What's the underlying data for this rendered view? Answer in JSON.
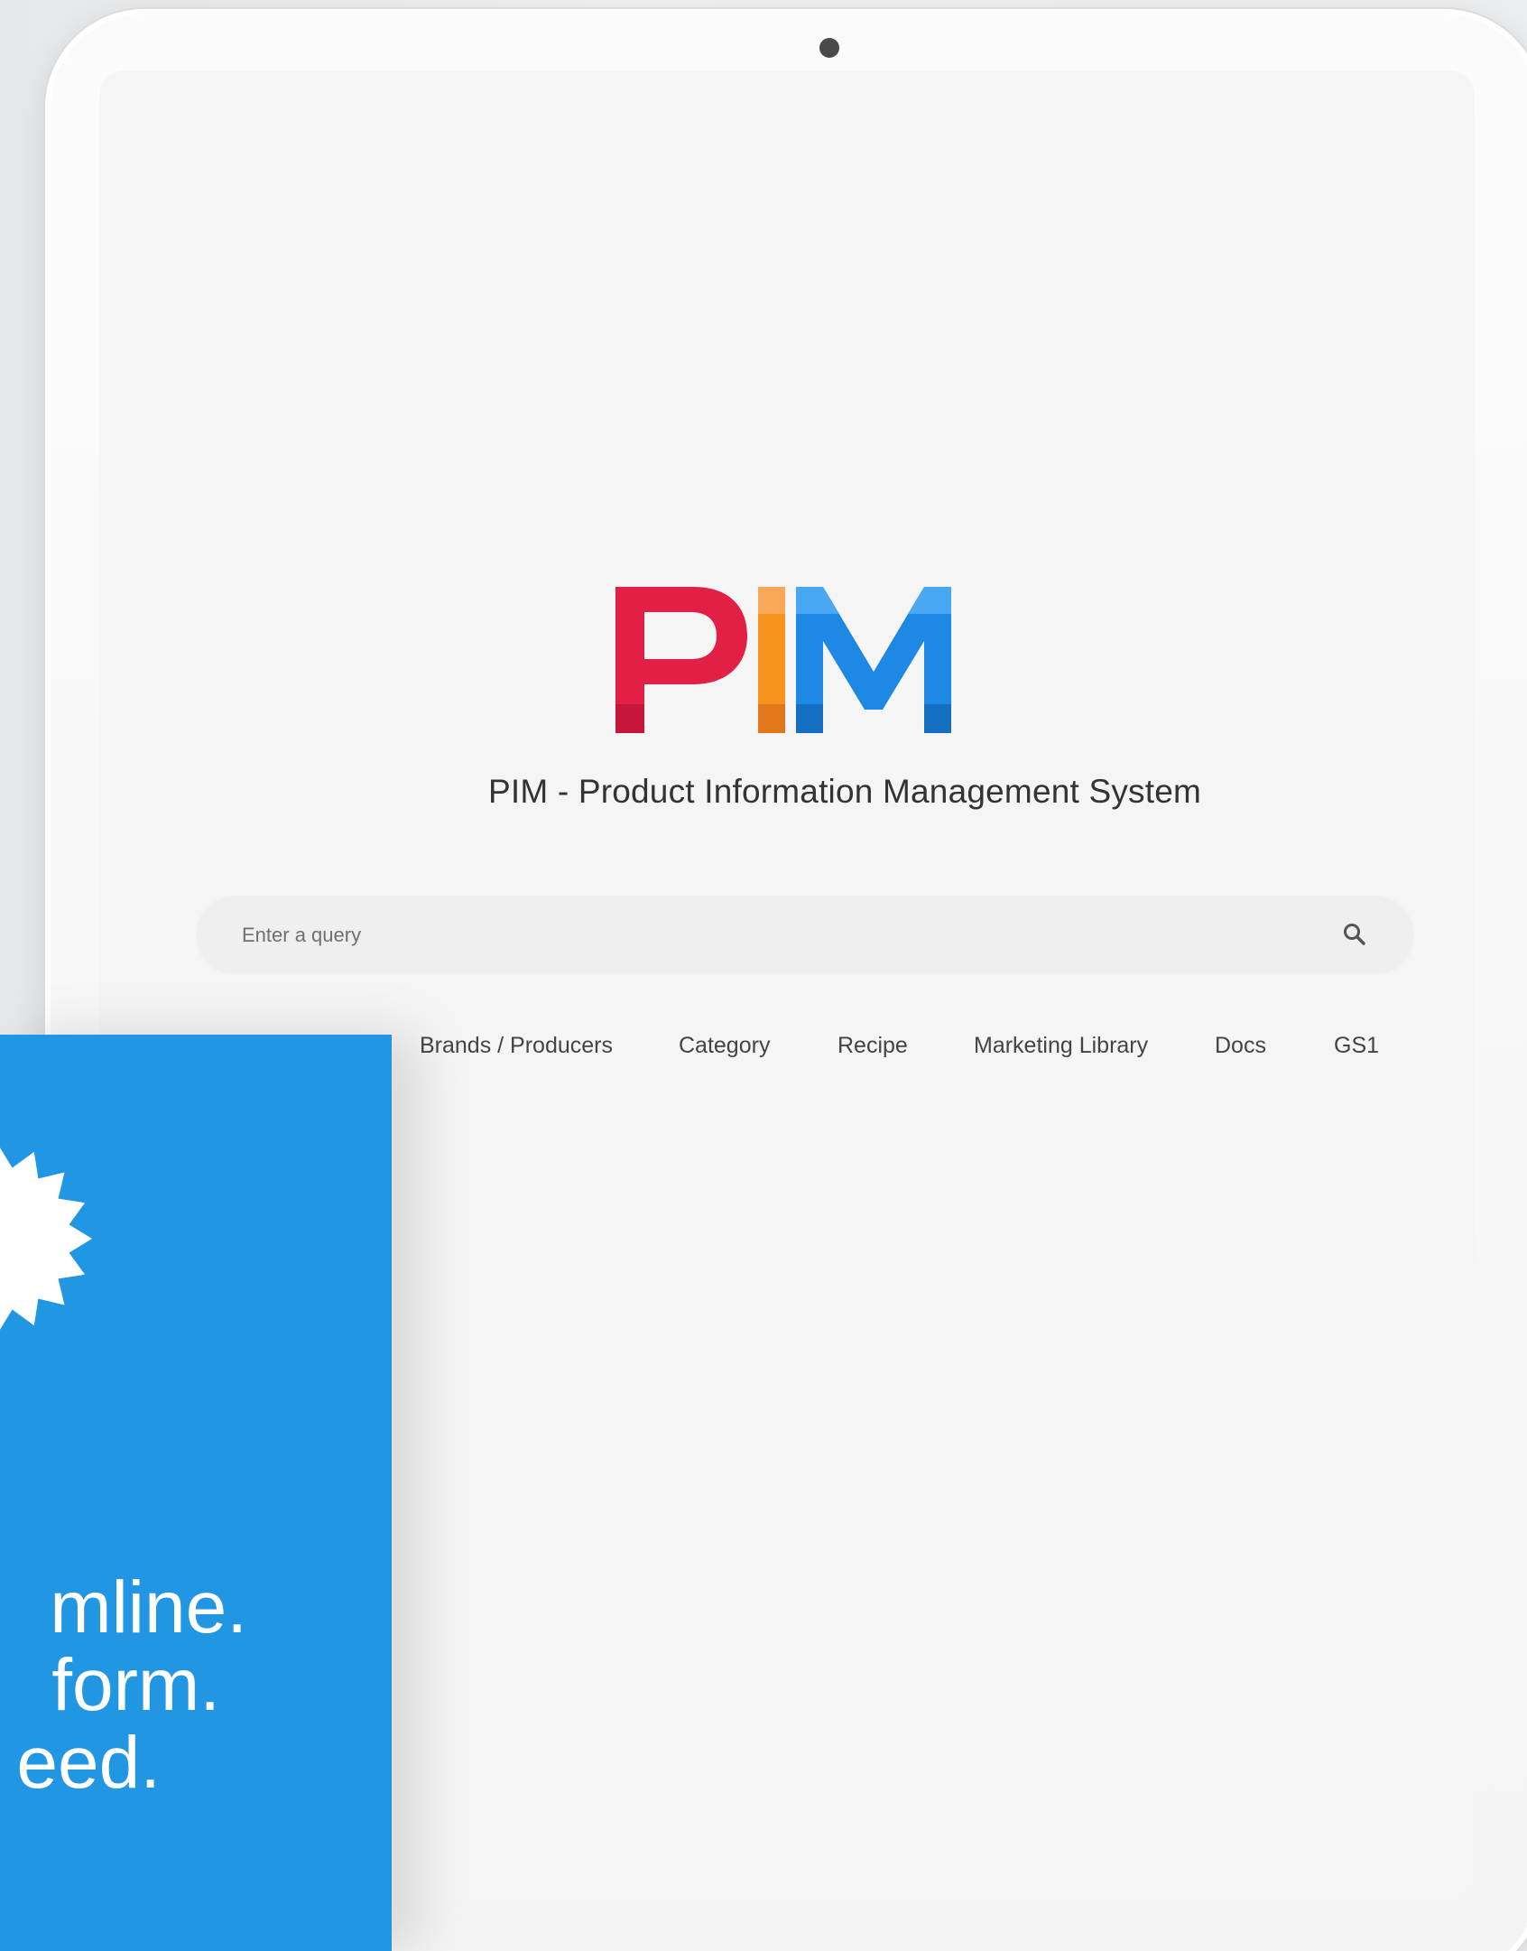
{
  "logo": {
    "letters": [
      "P",
      "I",
      "M"
    ],
    "colors": {
      "p": "#e21f44",
      "p_dark": "#c8153a",
      "i": "#f7941d",
      "i_light": "#f9a85a",
      "i_dark": "#e0771a",
      "m": "#1e88e5",
      "m_light": "#4aa8f2",
      "m_dark": "#1570c4"
    }
  },
  "subtitle": "PIM - Product Information Management System",
  "search": {
    "placeholder": "Enter a query",
    "icon": "search-icon"
  },
  "nav": {
    "items": [
      {
        "label": "Brands / Producers"
      },
      {
        "label": "Category"
      },
      {
        "label": "Recipe"
      },
      {
        "label": "Marketing Library"
      },
      {
        "label": "Docs"
      },
      {
        "label": "GS1"
      }
    ]
  },
  "promo": {
    "background": "#2196e3",
    "icon": "gear-icon",
    "lines": [
      "mline.",
      "form.",
      "eed."
    ]
  }
}
